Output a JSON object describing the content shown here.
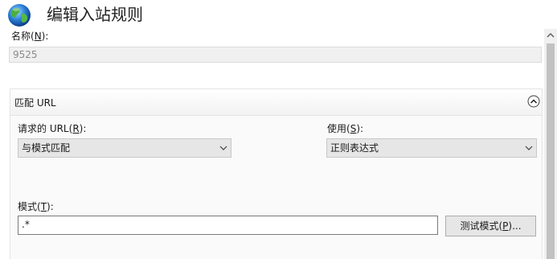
{
  "header": {
    "title": "编辑入站规则",
    "icon": "globe-icon"
  },
  "name": {
    "label_prefix": "名称(",
    "label_key": "N",
    "label_suffix": "):",
    "value": "9525"
  },
  "match_url_section": {
    "title": "匹配 URL",
    "collapse_icon": "chevron-up-circle-icon",
    "requested_url": {
      "label_prefix": "请求的 URL(",
      "label_key": "R",
      "label_suffix": "):",
      "selected": "与模式匹配"
    },
    "using": {
      "label_prefix": "使用(",
      "label_key": "S",
      "label_suffix": "):",
      "selected": "正则表达式"
    },
    "pattern": {
      "label_prefix": "模式(",
      "label_key": "T",
      "label_suffix": "):",
      "value": ".*"
    },
    "test_button": {
      "label_prefix": "测试模式(",
      "label_key": "P",
      "label_suffix": ")..."
    }
  },
  "colors": {
    "field_disabled_bg": "#f0f0f0",
    "dropdown_bg": "#e6e6e6",
    "section_bg": "#fafafa",
    "scroll_thumb": "#c2c2c2"
  }
}
